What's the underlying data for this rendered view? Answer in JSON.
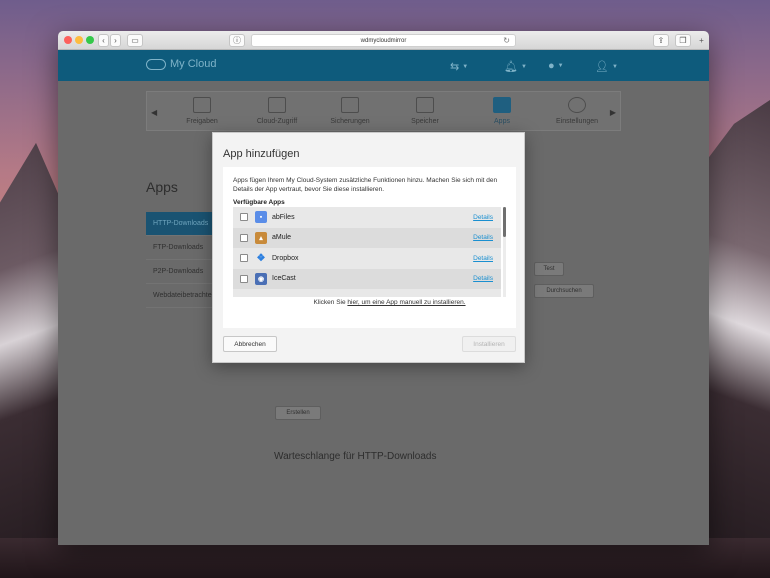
{
  "browser": {
    "url": "wdmycloudmirror"
  },
  "header": {
    "logo_text": "My Cloud"
  },
  "nav": {
    "items": [
      {
        "label": "Freigaben"
      },
      {
        "label": "Cloud-Zugriff"
      },
      {
        "label": "Sicherungen"
      },
      {
        "label": "Speicher"
      },
      {
        "label": "Apps"
      },
      {
        "label": "Einstellungen"
      }
    ]
  },
  "page": {
    "title": "Apps",
    "side_items": [
      {
        "label": "HTTP-Downloads"
      },
      {
        "label": "FTP-Downloads"
      },
      {
        "label": "P2P-Downloads"
      },
      {
        "label": "Webdateibetrachter"
      }
    ],
    "bg_buttons": {
      "test": "Test",
      "browse": "Durchsuchen",
      "create": "Erstellen"
    },
    "queue_title": "Warteschlange für HTTP-Downloads"
  },
  "modal": {
    "title": "App hinzufügen",
    "description": "Apps fügen Ihrem My Cloud-System zusätzliche Funktionen hinzu. Machen Sie sich mit den Details der App vertraut, bevor Sie diese installieren.",
    "available_heading": "Verfügbare Apps",
    "apps": [
      {
        "name": "abFiles",
        "details": "Details",
        "icon": "abfiles-icon",
        "color": "#5a8de8"
      },
      {
        "name": "aMule",
        "details": "Details",
        "icon": "amule-icon",
        "color": "#c88a3a"
      },
      {
        "name": "Dropbox",
        "details": "Details",
        "icon": "dropbox-icon",
        "color": "#2b7fe0"
      },
      {
        "name": "IceCast",
        "details": "Details",
        "icon": "icecast-icon",
        "color": "#4a6fb5"
      }
    ],
    "manual_prefix": "Klicken Sie",
    "manual_link": "hier, um eine App manuell zu installieren.",
    "cancel_label": "Abbrechen",
    "install_label": "Installieren"
  }
}
